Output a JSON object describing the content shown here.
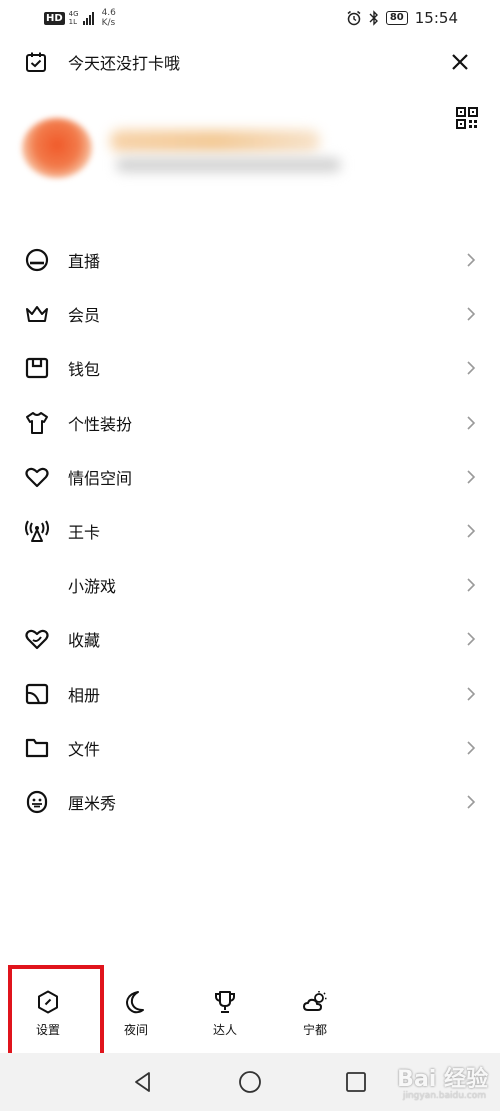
{
  "status_bar": {
    "hd": "HD",
    "network": "4G",
    "network_sub": "1L",
    "speed_value": "4.6",
    "speed_unit": "K/s",
    "battery": "80",
    "time": "15:54"
  },
  "header": {
    "checkin_text": "今天还没打卡哦"
  },
  "menu": {
    "items": [
      {
        "label": "直播",
        "icon": "live-icon"
      },
      {
        "label": "会员",
        "icon": "crown-icon"
      },
      {
        "label": "钱包",
        "icon": "wallet-icon"
      },
      {
        "label": "个性装扮",
        "icon": "tshirt-icon"
      },
      {
        "label": "情侣空间",
        "icon": "heart-icon"
      },
      {
        "label": "王卡",
        "icon": "antenna-icon"
      },
      {
        "label": "小游戏",
        "icon": ""
      },
      {
        "label": "收藏",
        "icon": "favorite-heart-icon"
      },
      {
        "label": "相册",
        "icon": "album-icon"
      },
      {
        "label": "文件",
        "icon": "folder-icon"
      },
      {
        "label": "厘米秀",
        "icon": "face-icon"
      }
    ]
  },
  "bottom_bar": {
    "settings_label": "设置",
    "night_label": "夜间",
    "expert_label": "达人",
    "weather_label": "宁都"
  },
  "watermark": {
    "brand": "Bai 经验",
    "url": "jingyan.baidu.com"
  },
  "colors": {
    "highlight": "#e0141c",
    "nav_bg": "#f2f2f2"
  }
}
